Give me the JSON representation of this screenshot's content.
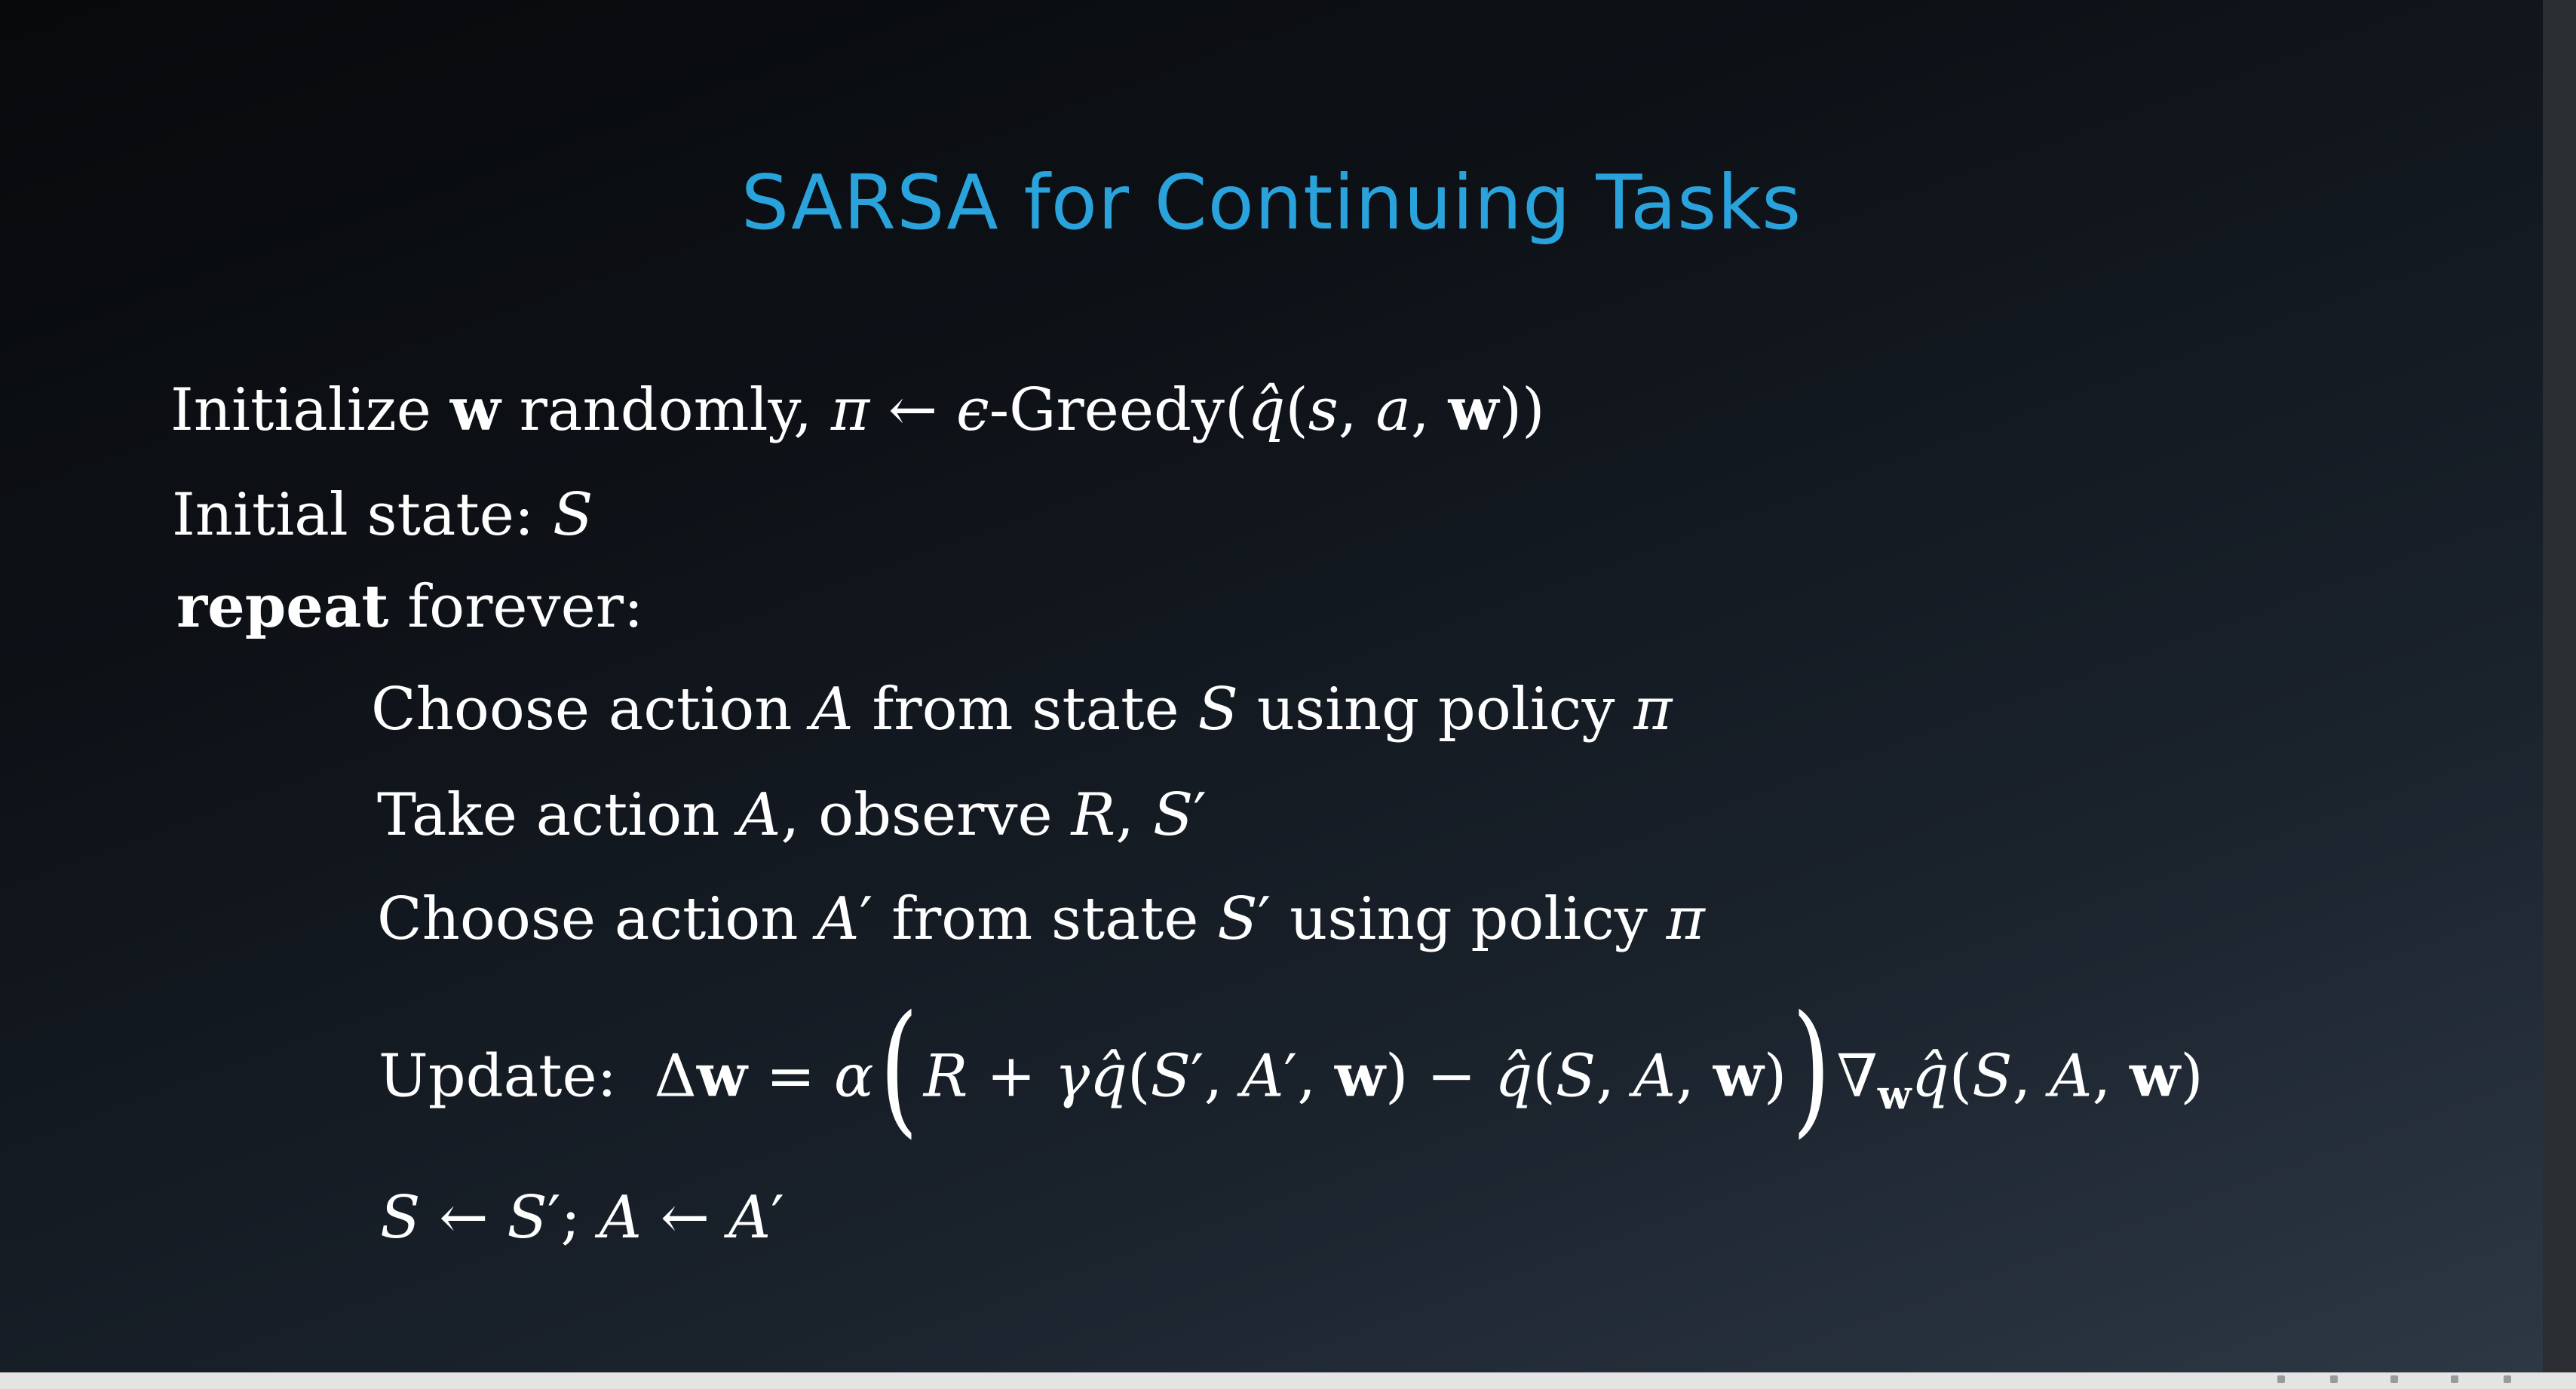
{
  "title": "SARSA for Continuing Tasks",
  "lines": [
    "Initialize w randomly, π ← ϵ-Greedy(q̂(s, a, w))",
    "Initial state: S",
    "repeat forever:",
    "Choose action A from state S using policy π",
    "Take action A, observe R, S′",
    "Choose action A′ from state S′ using policy π",
    "Update: Δw = α(R + γq̂(S′, A′, w) − q̂(S, A, w))∇wq̂(S, A, w)",
    "S ← S′; A ← A′"
  ],
  "colors": {
    "title": "#2aa3dc",
    "text": "#ffffff",
    "background_dark": "#08090b",
    "background_light": "#2d3844"
  }
}
